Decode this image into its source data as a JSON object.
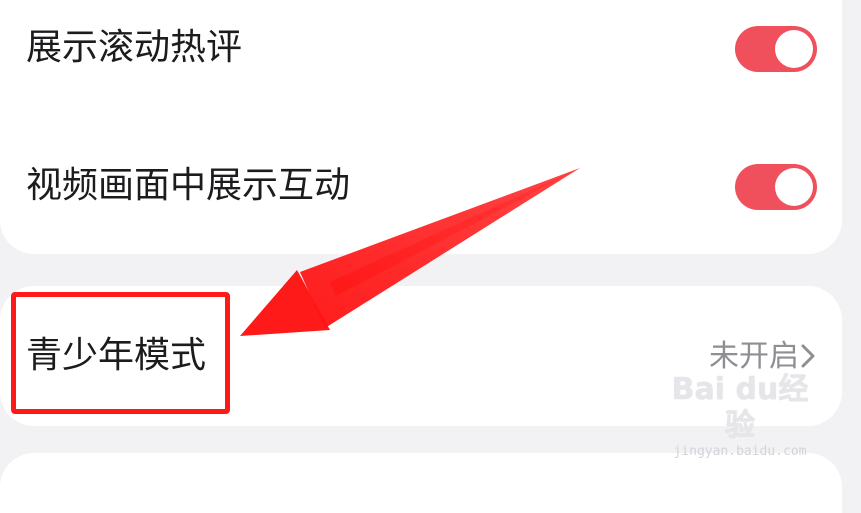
{
  "settings": {
    "rows": [
      {
        "label": "展示滚动热评",
        "toggle_on": true
      },
      {
        "label": "视频画面中展示互动",
        "toggle_on": true
      }
    ],
    "teen_mode": {
      "label": "青少年模式",
      "status": "未开启"
    }
  },
  "watermark": {
    "logo": "Bai du经验",
    "url": "jingyan.baidu.com"
  },
  "colors": {
    "toggle_on": "#f0505c",
    "annotation_red": "#ff1a1a",
    "background": "#f2f2f4",
    "card": "#ffffff"
  },
  "icons": {
    "chevron": "chevron-right-icon",
    "annotation_arrow": "red-arrow-icon"
  }
}
